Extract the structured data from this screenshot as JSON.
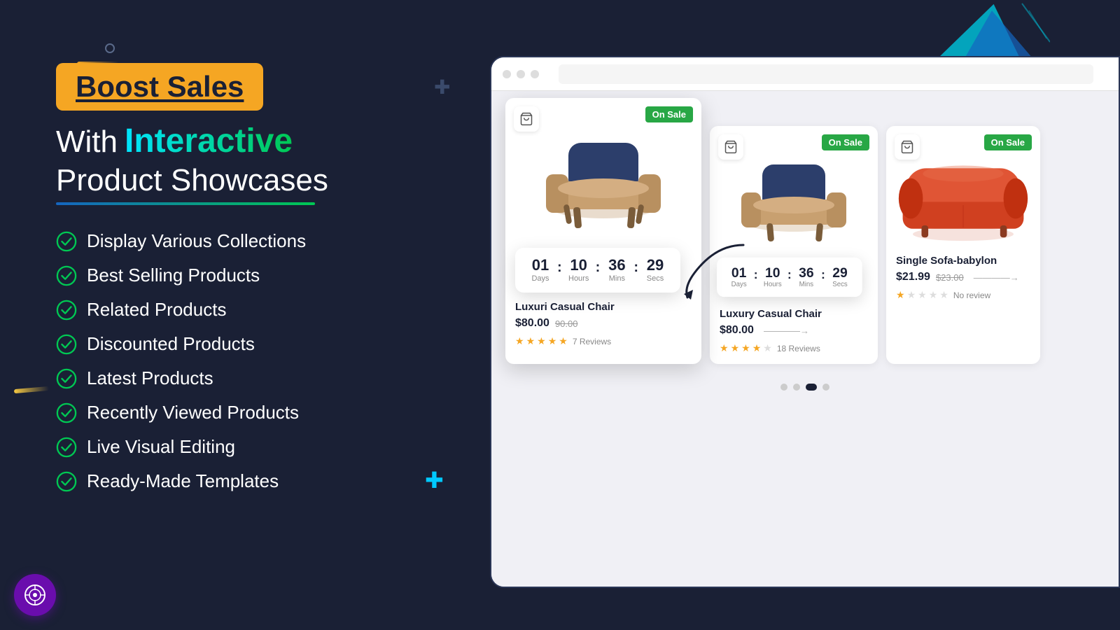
{
  "page": {
    "background_color": "#1a2035"
  },
  "left": {
    "badge": "Boost Sales",
    "headline_with": "With",
    "headline_interactive": "Interactive",
    "headline_product": "Product Showcases",
    "features": [
      {
        "id": "display-collections",
        "text": "Display Various Collections"
      },
      {
        "id": "best-selling",
        "text": "Best Selling Products"
      },
      {
        "id": "related-products",
        "text": "Related Products"
      },
      {
        "id": "discounted",
        "text": "Discounted Products"
      },
      {
        "id": "latest",
        "text": "Latest Products"
      },
      {
        "id": "recently-viewed",
        "text": "Recently Viewed Products"
      },
      {
        "id": "live-editing",
        "text": "Live Visual Editing"
      },
      {
        "id": "ready-templates",
        "text": "Ready-Made Templates"
      }
    ]
  },
  "right": {
    "cards": [
      {
        "id": "card-front",
        "name": "Luxuri Casual Chair",
        "badge": "On Sale",
        "price_current": "$80.00",
        "price_old": "90.00",
        "stars": 5,
        "reviews": "7 Reviews",
        "countdown": {
          "days": "01",
          "days_label": "Days",
          "hours": "10",
          "hours_label": "Hours",
          "mins": "36",
          "mins_label": "Mins",
          "secs": "29",
          "secs_label": "Secs"
        }
      },
      {
        "id": "card-middle",
        "name": "Luxury Casual Chair",
        "badge": "On Sale",
        "price_current": "$80.00",
        "stars": 4,
        "reviews": "18 Reviews",
        "countdown": {
          "days": "01",
          "days_label": "Days",
          "hours": "10",
          "hours_label": "Hours",
          "mins": "36",
          "mins_label": "Mins",
          "secs": "29",
          "secs_label": "Secs"
        }
      },
      {
        "id": "card-right",
        "name": "Single Sofa-babylon",
        "badge": "On Sale",
        "price_current": "$21.99",
        "price_old": "$23.00",
        "stars": 1,
        "reviews": "No review"
      }
    ],
    "pagination": {
      "dots": [
        "inactive",
        "inactive",
        "active",
        "inactive"
      ]
    }
  },
  "icons": {
    "check": "✓",
    "cart": "🛒",
    "cross": "+",
    "circle": "○"
  }
}
